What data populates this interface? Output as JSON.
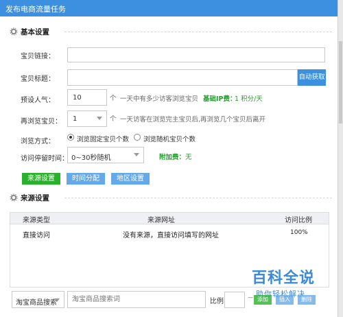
{
  "window": {
    "title": "发布电商流量任务"
  },
  "basic": {
    "section_title": "基本设置",
    "link_label": "宝贝链接：",
    "link_value": "",
    "title_label": "宝贝标题：",
    "title_value": "",
    "auto_fetch": "自动获取",
    "popularity_label": "预设人气：",
    "popularity_value": "10",
    "popularity_unit": "个",
    "popularity_hint": "一天中有多少访客浏览宝贝",
    "ip_fee_label": "基础IP费：",
    "ip_fee_value": "1 积分/天",
    "rebrowse_label": "再浏览宝贝：",
    "rebrowse_value": "1",
    "rebrowse_unit": "个",
    "rebrowse_hint": "一天访客在浏览完主宝贝后,再浏览几个宝贝后离开",
    "browse_mode_label": "浏览方式：",
    "browse_mode_options": [
      "浏览固定宝贝个数",
      "浏览随机宝贝个数"
    ],
    "browse_mode_selected": 0,
    "stay_label": "访问停留时间：",
    "stay_value": "0~30秒随机",
    "extra_fee_label": "附加费：",
    "extra_fee_value": "无"
  },
  "tabs": [
    {
      "label": "来源设置",
      "color": "#2ab12c"
    },
    {
      "label": "时间分配",
      "color": "#66a9e8"
    },
    {
      "label": "地区设置",
      "color": "#66a9e8"
    }
  ],
  "source": {
    "section_title": "来源设置",
    "columns": [
      "来源类型",
      "来源网址",
      "访问比例"
    ],
    "rows": [
      {
        "type": "直接访问",
        "url": "没有来源，直接访问填写的网址",
        "ratio": "100%"
      }
    ]
  },
  "bottom": {
    "select_value": "淘宝商品搜索",
    "keyword_placeholder": "淘宝商品搜索词",
    "ratio_label": "比例:",
    "ratio_value": "",
    "dash": "—",
    "btn_add": "添加",
    "btn_insert": "插入",
    "btn_delete": "删除"
  },
  "watermark": {
    "line1": "百科全说",
    "line2": "助你轻松解决"
  },
  "colors": {
    "accent": "#3d8fe0",
    "green": "#2ab12c"
  }
}
